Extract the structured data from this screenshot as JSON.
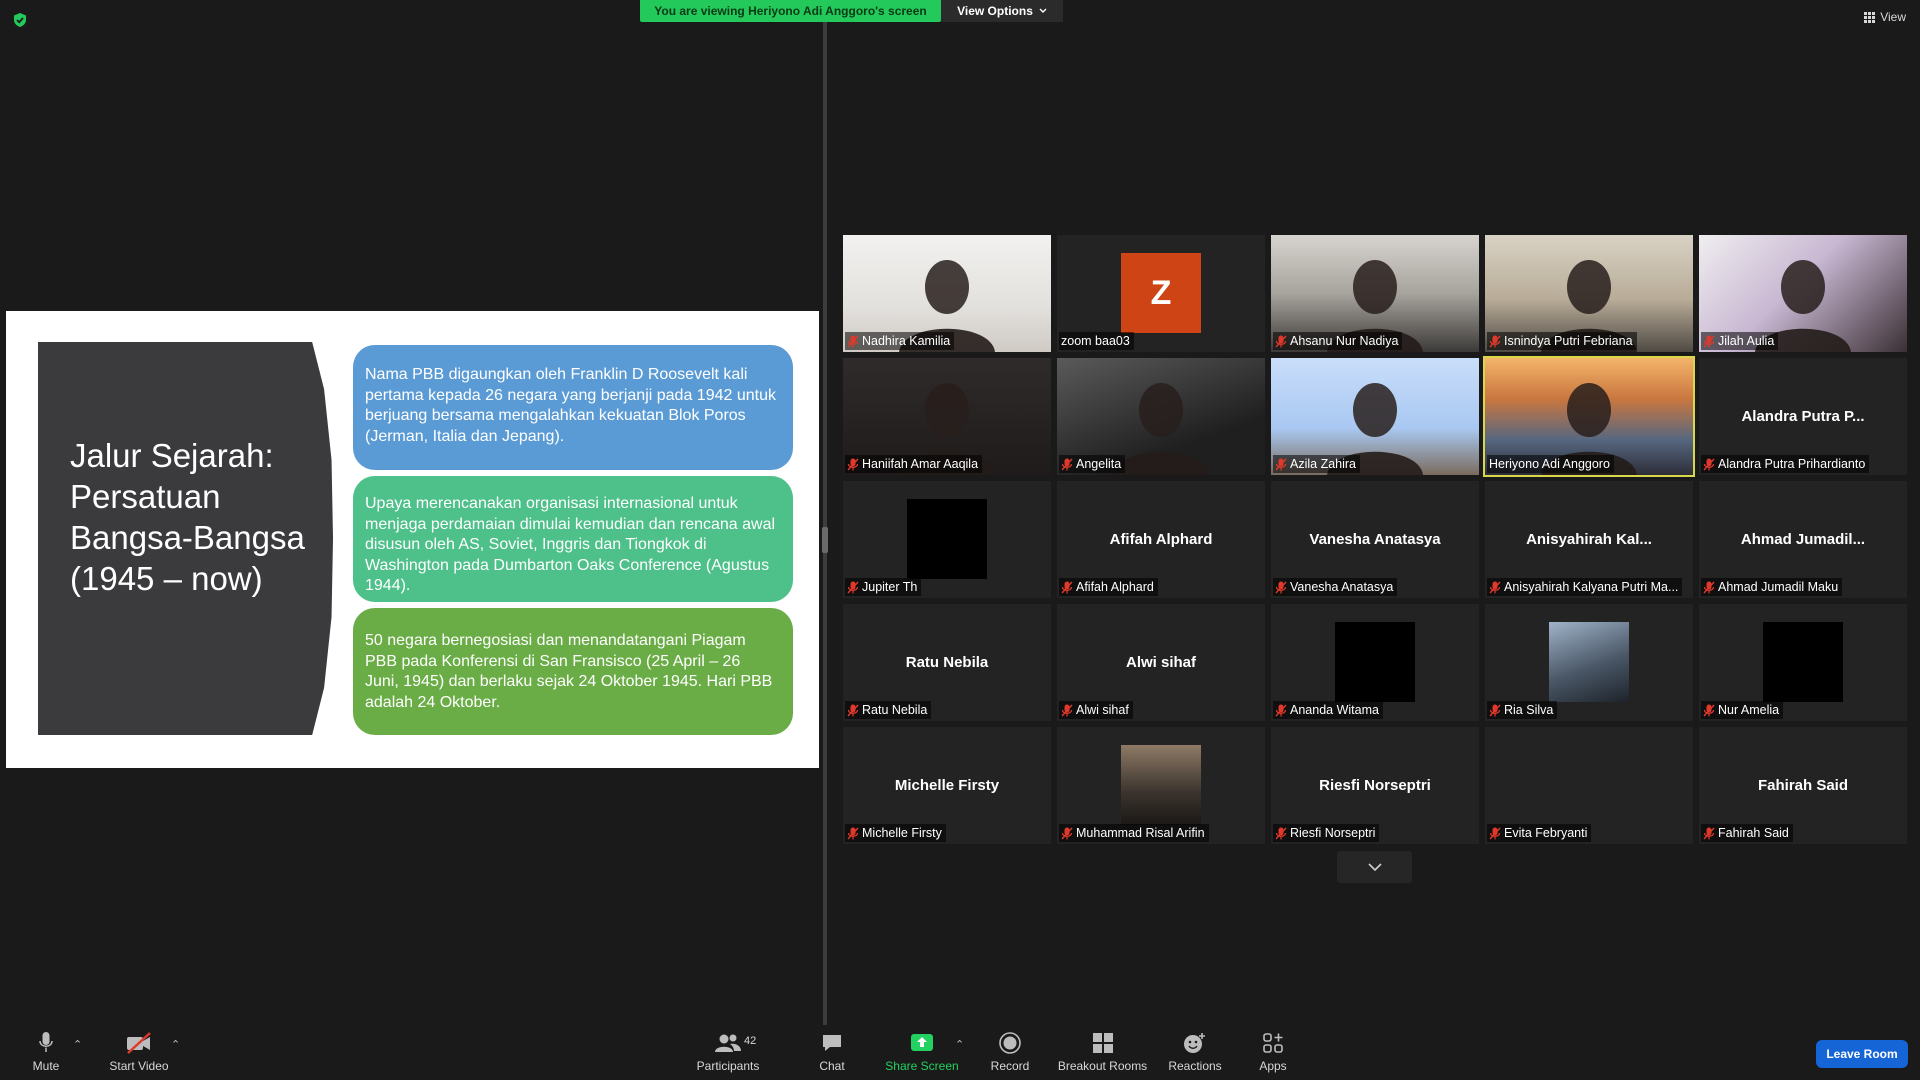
{
  "banner": {
    "text": "You are viewing Heriyono Adi Anggoro's screen"
  },
  "view_options": {
    "label": "View Options"
  },
  "view_button": {
    "label": "View"
  },
  "slide": {
    "title": "Jalur Sejarah: Persatuan Bangsa-Bangsa (1945 – now)",
    "points": [
      "Nama PBB digaungkan oleh Franklin D Roosevelt kali pertama kepada 26 negara yang berjanji pada 1942 untuk berjuang bersama mengalahkan kekuatan Blok Poros (Jerman, Italia dan Jepang).",
      "Upaya merencanakan organisasi internasional untuk menjaga perdamaian dimulai kemudian dan rencana awal disusun oleh AS, Soviet, Inggris dan Tiongkok di Washington pada Dumbarton Oaks Conference (Agustus 1944).",
      "50 negara bernegosiasi dan menandatangani Piagam PBB pada Konferensi di San Fransisco (25 April – 26 Juni, 1945) dan berlaku sejak 24 Oktober 1945. Hari PBB adalah 24 Oktober."
    ],
    "colors": {
      "point1": "#5b9bd5",
      "point2": "#4ec08a",
      "point3": "#6aad46",
      "title_box": "#3b3b3e"
    }
  },
  "participants_grid": [
    {
      "label": "Nadhira Kamilia",
      "big": "",
      "muted": true,
      "kind": "cam"
    },
    {
      "label": "zoom baa03",
      "big": "",
      "muted": false,
      "kind": "avatar",
      "avatar_letter": "Z"
    },
    {
      "label": "Ahsanu Nur Nadiya",
      "big": "",
      "muted": true,
      "kind": "cam"
    },
    {
      "label": "Isnindya Putri Febriana",
      "big": "",
      "muted": true,
      "kind": "cam"
    },
    {
      "label": "Jilah Aulia",
      "big": "",
      "muted": true,
      "kind": "cam"
    },
    {
      "label": "Haniifah Amar Aaqila",
      "big": "",
      "muted": true,
      "kind": "cam"
    },
    {
      "label": "Angelita",
      "big": "",
      "muted": true,
      "kind": "cam"
    },
    {
      "label": "Azila Zahira",
      "big": "",
      "muted": true,
      "kind": "cam"
    },
    {
      "label": "Heriyono Adi Anggoro",
      "big": "",
      "muted": false,
      "kind": "cam",
      "active": true
    },
    {
      "label": "Alandra Putra Prihardianto",
      "big": "Alandra Putra P...",
      "muted": true,
      "kind": "name"
    },
    {
      "label": "Jupiter Th",
      "big": "",
      "muted": true,
      "kind": "black"
    },
    {
      "label": "Afifah Alphard",
      "big": "Afifah Alphard",
      "muted": true,
      "kind": "name"
    },
    {
      "label": "Vanesha Anatasya",
      "big": "Vanesha Anatasya",
      "muted": true,
      "kind": "name"
    },
    {
      "label": "Anisyahirah Kalyana Putri Ma...",
      "big": "Anisyahirah Kal...",
      "muted": true,
      "kind": "name"
    },
    {
      "label": "Ahmad Jumadil Maku",
      "big": "Ahmad Jumadil...",
      "muted": true,
      "kind": "name"
    },
    {
      "label": "Ratu Nebila",
      "big": "Ratu Nebila",
      "muted": true,
      "kind": "name"
    },
    {
      "label": "Alwi sihaf",
      "big": "Alwi sihaf",
      "muted": true,
      "kind": "name"
    },
    {
      "label": "Ananda Witama",
      "big": "",
      "muted": true,
      "kind": "black"
    },
    {
      "label": "Ria Silva",
      "big": "",
      "muted": true,
      "kind": "photo"
    },
    {
      "label": "Nur Amelia",
      "big": "",
      "muted": true,
      "kind": "black"
    },
    {
      "label": "Michelle Firsty",
      "big": "Michelle Firsty",
      "muted": true,
      "kind": "name"
    },
    {
      "label": "Muhammad Risal Arifin",
      "big": "",
      "muted": true,
      "kind": "photo2"
    },
    {
      "label": "Riesfi Norseptri",
      "big": "Riesfi Norseptri",
      "muted": true,
      "kind": "name"
    },
    {
      "label": "Evita Febryanti",
      "big": "",
      "muted": true,
      "kind": "name"
    },
    {
      "label": "Fahirah Said",
      "big": "Fahirah Said",
      "muted": true,
      "kind": "name"
    }
  ],
  "toolbar": {
    "mute": "Mute",
    "start_video": "Start Video",
    "participants": "Participants",
    "participants_count": "42",
    "chat": "Chat",
    "share_screen": "Share Screen",
    "record": "Record",
    "breakout_rooms": "Breakout Rooms",
    "reactions": "Reactions",
    "apps": "Apps",
    "leave": "Leave Room"
  },
  "icons": [
    "shield-icon",
    "grid-icon",
    "chevron-down-icon",
    "mic-icon",
    "video-off-icon",
    "participants-icon",
    "chat-icon",
    "share-arrow-icon",
    "record-icon",
    "breakout-icon",
    "reactions-icon",
    "apps-icon",
    "mic-off-icon"
  ],
  "colors": {
    "accent_green": "#23c95a",
    "leave": "#1565d6",
    "active_speaker": "#d8d84a",
    "muted_red": "#e0392b"
  }
}
